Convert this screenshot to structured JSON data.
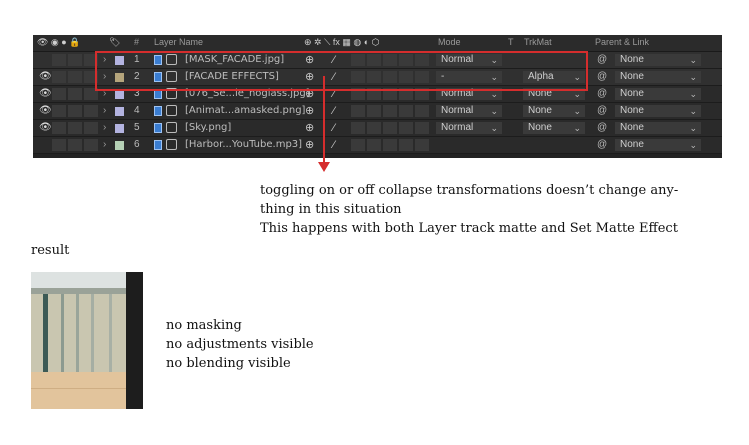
{
  "timeline": {
    "headers": {
      "layer_name": "Layer Name",
      "switches": "⊕ ✲ ⟍ fx ▦ ◍ ◐ ⬡",
      "mode": "Mode",
      "t": "T",
      "trkmat": "TrkMat",
      "parent": "Parent & Link",
      "hash": "#"
    },
    "layers": [
      {
        "num": "1",
        "name": "[MASK_FACADE.jpg]",
        "mode": "Normal",
        "trkmat": "",
        "parent": "None",
        "label_color": "#b3b3e0",
        "visible": false,
        "selected": true
      },
      {
        "num": "2",
        "name": "[FACADE EFFECTS]",
        "mode": "-",
        "trkmat": "Alpha",
        "parent": "None",
        "label_color": "#b5a57c",
        "visible": true,
        "selected": true
      },
      {
        "num": "3",
        "name": "[076_Se...le_noglass.jpg]",
        "mode": "Normal",
        "trkmat": "None",
        "parent": "None",
        "label_color": "#b3b3e0",
        "visible": true,
        "selected": false
      },
      {
        "num": "4",
        "name": "[Animat...amasked.png]",
        "mode": "Normal",
        "trkmat": "None",
        "parent": "None",
        "label_color": "#b3b3e0",
        "visible": true,
        "selected": false
      },
      {
        "num": "5",
        "name": "[Sky.png]",
        "mode": "Normal",
        "trkmat": "None",
        "parent": "None",
        "label_color": "#b3b3e0",
        "visible": true,
        "selected": false
      },
      {
        "num": "6",
        "name": "[Harbor...YouTube.mp3]",
        "mode": "",
        "trkmat": "",
        "parent": "None",
        "label_color": "#b5d0b5",
        "visible": false,
        "selected": false
      }
    ]
  },
  "annotation": {
    "line1": "toggling on or off collapse transformations doesn’t change any-",
    "line2": "thing in this situation",
    "line3": "This happens with both Layer track matte and Set Matte Effect"
  },
  "result_label": "result",
  "result_notes": [
    "no masking",
    "no adjustments visible",
    "no blending visible"
  ],
  "colors": {
    "highlight": "#d52d2d",
    "panel_bg": "#232323"
  }
}
